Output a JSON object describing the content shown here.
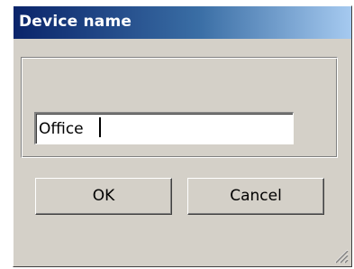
{
  "dialog": {
    "title": "Device name",
    "name_field": {
      "value": "Office",
      "placeholder": ""
    },
    "buttons": {
      "ok_label": "OK",
      "cancel_label": "Cancel"
    },
    "icons": {
      "resize_grip": "resize-grip-icon"
    },
    "colors": {
      "face": "#d4d0c8",
      "title_start": "#0a246a",
      "title_end": "#a6caf0",
      "title_text": "#ffffff"
    }
  }
}
